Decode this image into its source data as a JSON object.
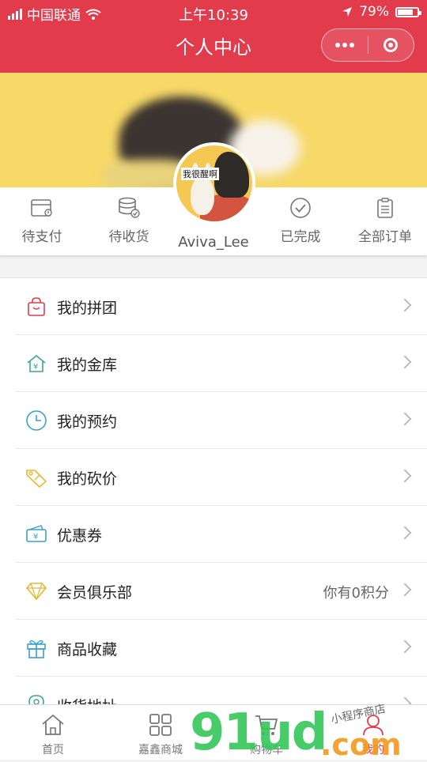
{
  "status": {
    "carrier": "中国联通",
    "time": "上午10:39",
    "battery": "79%",
    "battery_level": 0.79
  },
  "header": {
    "title": "个人中心"
  },
  "profile": {
    "username": "Aviva_Lee",
    "avatar_text": "我很醒啊"
  },
  "orders": [
    {
      "label": "待支付",
      "icon": "wallet-icon"
    },
    {
      "label": "待收货",
      "icon": "package-icon"
    },
    {
      "label": "已完成",
      "icon": "check-circle-icon"
    },
    {
      "label": "全部订单",
      "icon": "clipboard-icon"
    }
  ],
  "menu": [
    {
      "label": "我的拼团",
      "icon": "bag-icon",
      "color": "#e23b4c",
      "extra": ""
    },
    {
      "label": "我的金库",
      "icon": "vault-icon",
      "color": "#3aa88a",
      "extra": ""
    },
    {
      "label": "我的预约",
      "icon": "clock-icon",
      "color": "#3aa2c8",
      "extra": ""
    },
    {
      "label": "我的砍价",
      "icon": "price-tag-icon",
      "color": "#e6b830",
      "extra": ""
    },
    {
      "label": "优惠券",
      "icon": "coupon-icon",
      "color": "#3aa2c8",
      "extra": ""
    },
    {
      "label": "会员俱乐部",
      "icon": "diamond-icon",
      "color": "#e6b830",
      "extra": "你有0积分"
    },
    {
      "label": "商品收藏",
      "icon": "gift-icon",
      "color": "#3aa2c8",
      "extra": ""
    },
    {
      "label": "收货地址",
      "icon": "location-icon",
      "color": "#3aa88a",
      "extra": ""
    }
  ],
  "tabs": [
    {
      "label": "首页",
      "icon": "home-icon"
    },
    {
      "label": "嘉鑫商城",
      "icon": "grid-icon"
    },
    {
      "label": "购物车",
      "icon": "cart-icon"
    },
    {
      "label": "我的",
      "icon": "user-icon"
    }
  ],
  "watermark": {
    "main": "91ud",
    "suffix": ".com",
    "small": "小程序商店"
  },
  "colors": {
    "brand": "#e23b4c",
    "banner": "#f7d968"
  }
}
